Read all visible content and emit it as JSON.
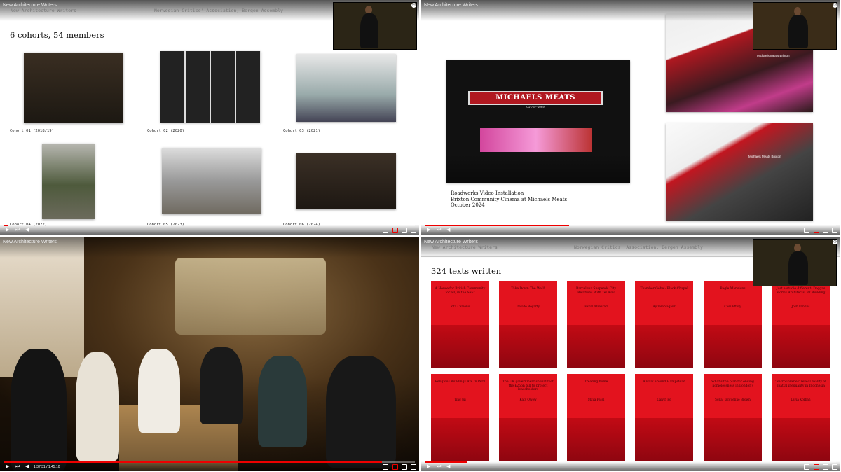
{
  "panel1": {
    "video_title": "New Architecture Writers",
    "slide_header_left": "New Architecture Writers",
    "slide_header_right": "Norwegian Critics' Association, Bergen Assembly",
    "heading": "6 cohorts, 54 members",
    "captions": [
      "Cohort 01 (2018/19)",
      "Cohort 02 (2020)",
      "Cohort 03 (2021)",
      "Cohort 04 (2022)",
      "Cohort 05 (2023)",
      "Cohort 06 (2024)"
    ],
    "progress": 0.01
  },
  "panel2": {
    "video_title": "New Architecture Writers",
    "sign_text": "MICHAELS MEATS",
    "sign_phone": "01-737-1069",
    "caption_line1": "Roadworks Video Installation",
    "caption_line2": "Brixton Community Cinema at Michaels Meats",
    "caption_line3": "October 2024",
    "photo_sign": "Michaels Meats Brixton",
    "progress": 0.35
  },
  "panel3": {
    "video_title": "New Architecture Writers",
    "time": "1:37:31 / 1:45:10",
    "progress": 0.92
  },
  "panel4": {
    "video_title": "New Architecture Writers",
    "slide_header_left": "New Architecture Writers",
    "slide_header_right": "Norwegian Critics' Association, Bergen Assembly",
    "heading": "324 texts written",
    "covers": [
      {
        "title": "A House for British Community for all, in the Sea?",
        "author": "Rita Carsonu"
      },
      {
        "title": "Take Down The Wall!",
        "author": "Davide Bogarty"
      },
      {
        "title": "Barcelona Suspends City Relations With Tel Aviv",
        "author": "Farial Maaarad"
      },
      {
        "title": "Thamber Gobel: Black Chapel",
        "author": "Ajuram Saqaur"
      },
      {
        "title": "Bagle Mansions",
        "author": "Cass Effory"
      },
      {
        "title": "Just a studio different: Doggas Morris Architects' BT Building",
        "author": "Josh Fannus"
      },
      {
        "title": "Religious Buildings Are In Peril",
        "author": "Ting Jui"
      },
      {
        "title": "The UK government should foot the £25bn bill to protect leaseholders",
        "author": "Katy Owow"
      },
      {
        "title": "Treating home",
        "author": "Maya Patel"
      },
      {
        "title": "A walk around Hampstead",
        "author": "Calvin Fo"
      },
      {
        "title": "What's the plan for ending homelessness in London?",
        "author": "Sonal Jacqueline Brown"
      },
      {
        "title": "'Microlibraries' reveal reality of spatial inequality in Indonesia",
        "author": "Lavia Korban"
      }
    ],
    "progress": 0.1
  }
}
